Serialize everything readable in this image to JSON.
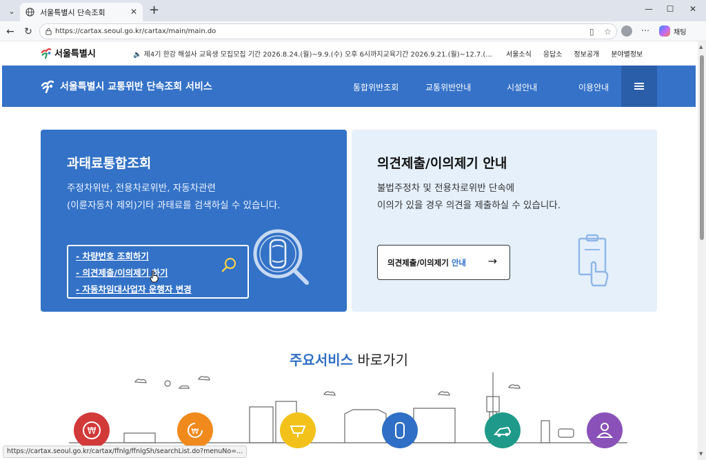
{
  "browser": {
    "tab_title": "서울특별시 단속조회",
    "url": "https://cartax.seoul.go.kr/cartax/main/main.do",
    "copilot_label": "채팅"
  },
  "util_bar": {
    "logo_text": "서울특별시",
    "notice": "제4기 한강 해설사 교육생 모집모집 기간 2026.8.24.(월)~9.9.(수) 오후 6시까지교육기간 2026.9.21.(월)~12.7.(...",
    "links": [
      "서울소식",
      "응답소",
      "정보공개",
      "분야별정보"
    ]
  },
  "header": {
    "brand": "서울특별시 교통위반 단속조회 서비스",
    "menu": [
      "통합위반조회",
      "교통위반안내",
      "시설안내",
      "이용안내"
    ]
  },
  "card_left": {
    "title": "과태료통합조회",
    "desc_line1": "주정차위반, 전용차로위반, 자동차관련",
    "desc_line2": "(이륜자동차 제외)기타 과태료를 검색하실 수 있습니다.",
    "links": [
      "- 차량번호 조회하기",
      "- 의견제출/이의제기 하기",
      "- 자동차임대사업자 운행자 변경"
    ]
  },
  "card_right": {
    "title": "의견제출/이의제기 안내",
    "desc_line1": "불법주정차 및 전용차로위반 단속에",
    "desc_line2": "이의가 있을 경우 의견을 제출하실 수 있습니다.",
    "button_text": "의견제출/이의제기",
    "button_accent": "안내"
  },
  "services": {
    "title_accent": "주요서비스",
    "title_rest": "바로가기"
  },
  "status_bar": "https://cartax.seoul.go.kr/cartax/ffnlg/ffnlgSh/searchList.do?menuNo=...",
  "colors": {
    "header_blue": "#3572c8",
    "card_blue": "#3372c6",
    "card_light": "#e5f0fb",
    "accent_blue": "#2f6fc5"
  }
}
